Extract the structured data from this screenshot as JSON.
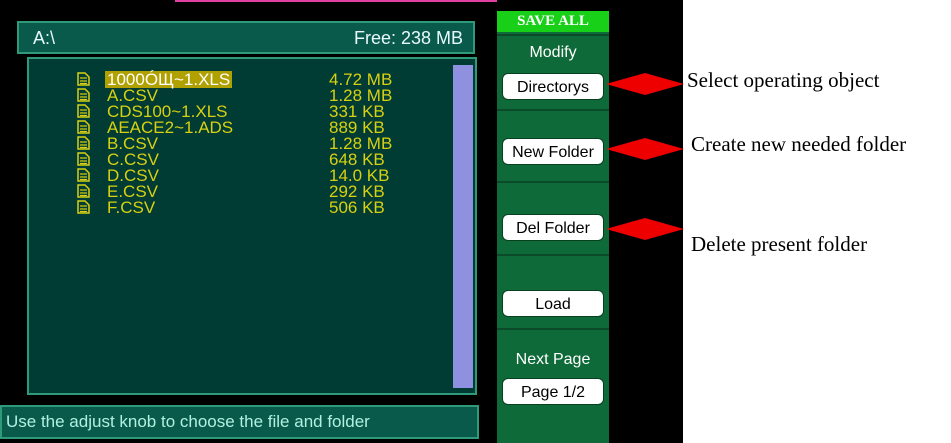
{
  "path": "A:\\",
  "free_space": "Free: 238 MB",
  "files": [
    {
      "name": "1000ÓЩ~1.XLS",
      "size": "4.72 MB",
      "selected": true
    },
    {
      "name": "A.CSV",
      "size": "1.28 MB",
      "selected": false
    },
    {
      "name": "CDS100~1.XLS",
      "size": "331 KB",
      "selected": false
    },
    {
      "name": "AEACE2~1.ADS",
      "size": "889 KB",
      "selected": false
    },
    {
      "name": "B.CSV",
      "size": "1.28 MB",
      "selected": false
    },
    {
      "name": "C.CSV",
      "size": "648 KB",
      "selected": false
    },
    {
      "name": "D.CSV",
      "size": "14.0 KB",
      "selected": false
    },
    {
      "name": "E.CSV",
      "size": "292 KB",
      "selected": false
    },
    {
      "name": "F.CSV",
      "size": "506 KB",
      "selected": false
    }
  ],
  "status_text": "Use the adjust knob to choose the file and folder",
  "menu": {
    "title": "SAVE ALL",
    "modify_label": "Modify",
    "directorys_button": "Directorys",
    "new_folder_button": "New Folder",
    "del_folder_button": "Del Folder",
    "load_button": "Load",
    "next_page_label": "Next Page",
    "page_button": "Page 1/2"
  },
  "annotations": {
    "select": "Select operating object",
    "create": "Create new needed folder",
    "delete": "Delete present folder"
  },
  "colors": {
    "accent": "#19d019",
    "arrow": "#ee0000",
    "file_text": "#d8d010",
    "selected_bg": "#b0a000"
  }
}
